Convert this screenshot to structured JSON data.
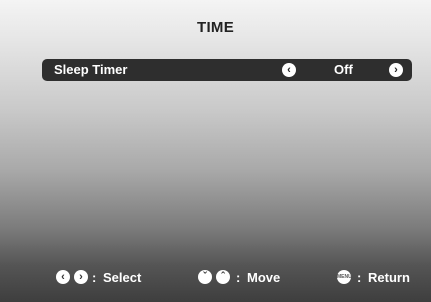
{
  "menu": {
    "title": "TIME",
    "rows": [
      {
        "label": "Sleep Timer",
        "value": "Off"
      }
    ]
  },
  "footer": {
    "select_sep": ":",
    "select_label": "Select",
    "move_sep": ":",
    "move_label": "Move",
    "return_sep": ":",
    "return_label": "Return",
    "menu_button_text": "MENU"
  },
  "icons": {
    "left": "chevron-left-icon",
    "right": "chevron-right-icon",
    "down": "chevron-down-icon",
    "up": "chevron-up-icon"
  }
}
